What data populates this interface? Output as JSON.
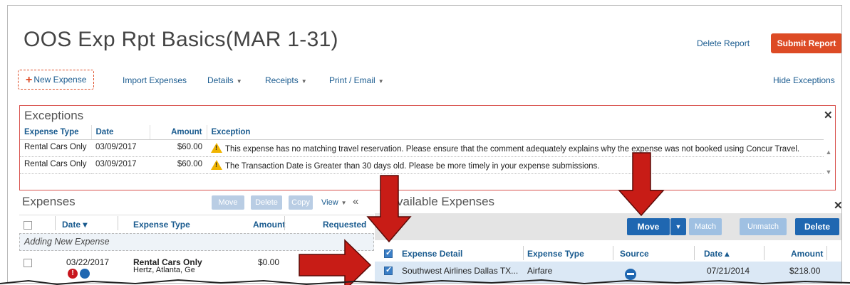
{
  "header": {
    "title": "OOS Exp Rpt Basics(MAR 1-31)",
    "delete_report": "Delete Report",
    "submit_report": "Submit Report"
  },
  "toolbar": {
    "new_expense": "New Expense",
    "import_expenses": "Import Expenses",
    "details": "Details",
    "receipts": "Receipts",
    "print_email": "Print / Email",
    "hide_exceptions": "Hide Exceptions"
  },
  "exceptions": {
    "title": "Exceptions",
    "columns": [
      "Expense Type",
      "Date",
      "Amount",
      "Exception"
    ],
    "rows": [
      {
        "type": "Rental Cars Only",
        "date": "03/09/2017",
        "amount": "$60.00",
        "message": "This expense has no matching travel reservation. Please ensure that the comment adequately explains why the expense was not booked using Concur Travel."
      },
      {
        "type": "Rental Cars Only",
        "date": "03/09/2017",
        "amount": "$60.00",
        "message": "The Transaction Date is Greater than 30 days old. Please be more timely in your expense submissions."
      }
    ]
  },
  "expenses": {
    "title": "Expenses",
    "move": "Move",
    "delete": "Delete",
    "copy": "Copy",
    "view": "View",
    "collapse": "«",
    "columns": [
      "Date ▾",
      "Expense Type",
      "Amount",
      "Requested"
    ],
    "adding_label": "Adding New Expense",
    "row": {
      "date": "03/22/2017",
      "type": "Rental Cars Only",
      "vendor": "Hertz, Atlanta, Georg",
      "amount": "$0.00"
    }
  },
  "available": {
    "title": "Available Expenses",
    "move": "Move",
    "match": "Match",
    "unmatch": "Unmatch",
    "delete": "Delete",
    "columns": [
      "Expense Detail",
      "Expense Type",
      "Source",
      "Date ▴",
      "Amount"
    ],
    "row": {
      "detail": "Southwest Airlines Dallas TX...",
      "type": "Airfare",
      "date": "07/21/2014",
      "amount": "$218.00"
    }
  },
  "colors": {
    "accent": "#dd4b25",
    "link": "#1a5b8f",
    "primary": "#1f67b1",
    "arrow": "#c81c16"
  }
}
